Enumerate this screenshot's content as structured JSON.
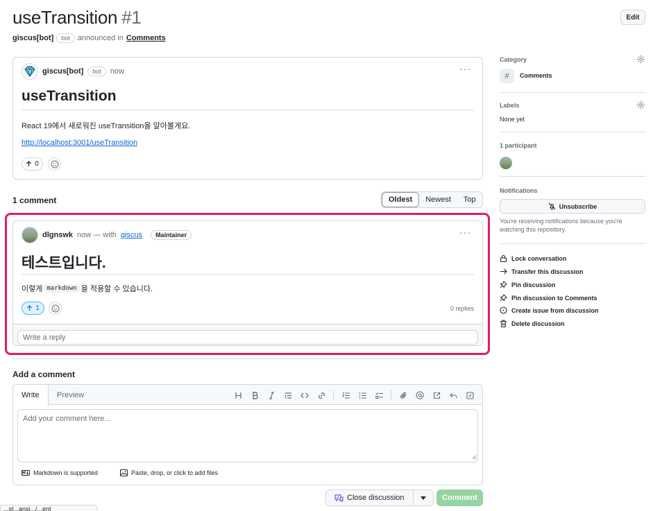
{
  "discussion": {
    "title": "useTransition",
    "number": "#1",
    "edit_label": "Edit",
    "author": "giscus[bot]",
    "author_badge": "bot",
    "announced_in": "announced in",
    "category": "Comments"
  },
  "post": {
    "author": "giscus[bot]",
    "badge": "bot",
    "time": "now",
    "menu": "···",
    "heading": "useTransition",
    "text": "React 19에서 새로워진 useTransition을 알아볼게요.",
    "link": "http://localhost:3001/useTransition",
    "upvotes": "0"
  },
  "comments_section": {
    "count_label": "1 comment",
    "sort_options": [
      "Oldest",
      "Newest",
      "Top"
    ],
    "active_sort": "Oldest"
  },
  "comment": {
    "author": "dlgnswk",
    "time_prefix": "now — with",
    "via": "giscus",
    "badge": "Maintainer",
    "menu": "···",
    "heading": "테스트입니다.",
    "text_before": "이렇게",
    "code": "markdown",
    "text_after": "을 적용할 수 있습니다.",
    "upvotes": "1",
    "replies": "0 replies",
    "reply_placeholder": "Write a reply"
  },
  "composer": {
    "title": "Add a comment",
    "tabs": [
      "Write",
      "Preview"
    ],
    "placeholder": "Add your comment here...",
    "markdown_note": "Markdown is supported",
    "files_note": "Paste, drop, or click to add files",
    "toolbar_icons": [
      "heading-icon",
      "bold-icon",
      "italic-icon",
      "quote-icon",
      "code-icon",
      "link-icon",
      "ordered-list-icon",
      "unordered-list-icon",
      "task-list-icon",
      "attach-icon",
      "mention-icon",
      "reference-icon",
      "reply-icon",
      "slash-icon"
    ]
  },
  "actions": {
    "close_label": "Close discussion",
    "comment_label": "Comment"
  },
  "sidebar": {
    "category_label": "Category",
    "category_value": "Comments",
    "category_glyph": "#",
    "labels_label": "Labels",
    "labels_value": "None yet",
    "participants_label": "1 participant",
    "notifications_label": "Notifications",
    "unsubscribe_label": "Unsubscribe",
    "notification_text": "You're receiving notifications because you're watching this repository.",
    "items": [
      {
        "label": "Lock conversation",
        "icon": "lock-icon"
      },
      {
        "label": "Transfer this discussion",
        "icon": "arrow-right-icon"
      },
      {
        "label": "Pin discussion",
        "icon": "pin-icon"
      },
      {
        "label": "Pin discussion to Comments",
        "icon": "pin-icon"
      },
      {
        "label": "Create issue from discussion",
        "icon": "issue-icon"
      },
      {
        "label": "Delete discussion",
        "icon": "trash-icon"
      }
    ]
  },
  "status_bar": {
    "url": "...st...ansi.../...ent"
  },
  "colors": {
    "highlight": "#e8195d",
    "link": "#0969da",
    "comment_button": "#94d3a2"
  }
}
